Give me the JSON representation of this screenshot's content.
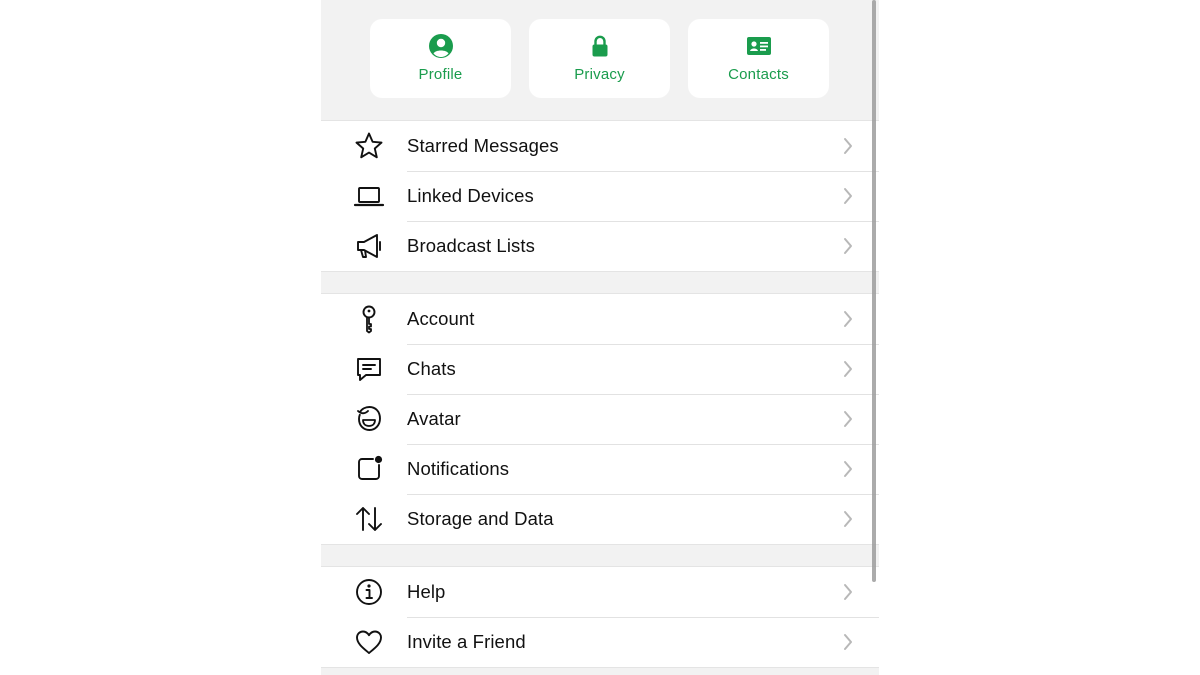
{
  "quick_actions": [
    {
      "label": "Profile",
      "icon": "profile-icon"
    },
    {
      "label": "Privacy",
      "icon": "lock-icon"
    },
    {
      "label": "Contacts",
      "icon": "contact-card-icon"
    }
  ],
  "accent_color": "#1a9c4d",
  "group1": [
    {
      "label": "Starred Messages",
      "icon": "star-icon"
    },
    {
      "label": "Linked Devices",
      "icon": "laptop-icon"
    },
    {
      "label": "Broadcast Lists",
      "icon": "megaphone-icon"
    }
  ],
  "group2": [
    {
      "label": "Account",
      "icon": "key-icon"
    },
    {
      "label": "Chats",
      "icon": "chat-bubble-icon"
    },
    {
      "label": "Avatar",
      "icon": "avatar-icon"
    },
    {
      "label": "Notifications",
      "icon": "notification-badge-icon"
    },
    {
      "label": "Storage and Data",
      "icon": "up-down-arrows-icon"
    }
  ],
  "group3": [
    {
      "label": "Help",
      "icon": "info-icon"
    },
    {
      "label": "Invite a Friend",
      "icon": "heart-icon"
    }
  ]
}
